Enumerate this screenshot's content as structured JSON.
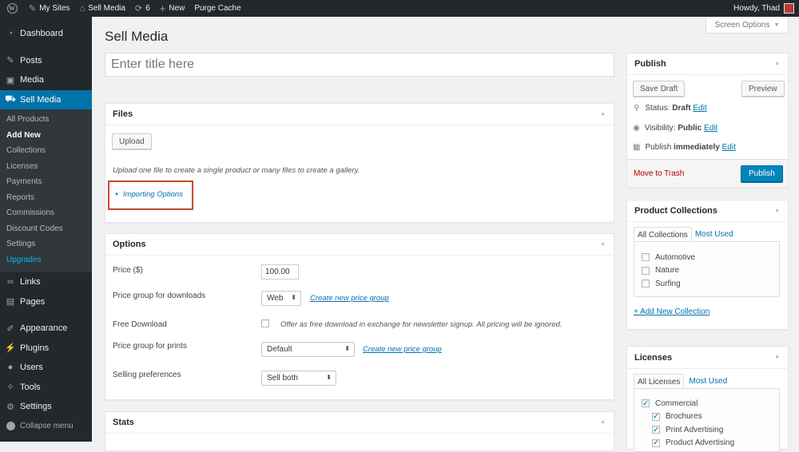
{
  "admin_bar": {
    "my_sites": "My Sites",
    "site_name": "Sell Media",
    "updates_count": "6",
    "new_label": "New",
    "purge_cache": "Purge Cache",
    "howdy": "Howdy, Thad"
  },
  "sidebar": {
    "dashboard": "Dashboard",
    "posts": "Posts",
    "media": "Media",
    "sell_media": "Sell Media",
    "submenu": [
      "All Products",
      "Add New",
      "Collections",
      "Licenses",
      "Payments",
      "Reports",
      "Commissions",
      "Discount Codes",
      "Settings",
      "Upgrades"
    ],
    "links": "Links",
    "pages": "Pages",
    "appearance": "Appearance",
    "plugins": "Plugins",
    "users": "Users",
    "tools": "Tools",
    "settings": "Settings",
    "collapse": "Collapse menu"
  },
  "page": {
    "title": "Sell Media",
    "screen_options": "Screen Options",
    "title_placeholder": "Enter title here"
  },
  "files_box": {
    "title": "Files",
    "upload_button": "Upload",
    "help_text": "Upload one file to create a single product or many files to create a gallery.",
    "importing_options": "Importing Options"
  },
  "options_box": {
    "title": "Options",
    "price_label": "Price ($)",
    "price_value": "100.00",
    "price_group_downloads_label": "Price group for downloads",
    "price_group_downloads_value": "Web",
    "create_price_group": "Create new price group",
    "free_download_label": "Free Download",
    "free_download_text": "Offer as free download in exchange for newsletter signup. All pricing will be ignored.",
    "price_group_prints_label": "Price group for prints",
    "price_group_prints_value": "Default",
    "selling_preferences_label": "Selling preferences",
    "selling_preferences_value": "Sell both"
  },
  "stats_box": {
    "title": "Stats"
  },
  "publish_box": {
    "title": "Publish",
    "save_draft": "Save Draft",
    "preview": "Preview",
    "status_label": "Status:",
    "status_value": "Draft",
    "visibility_label": "Visibility:",
    "visibility_value": "Public",
    "publish_label": "Publish",
    "publish_value": "immediately",
    "edit": "Edit",
    "move_to_trash": "Move to Trash",
    "publish_button": "Publish"
  },
  "collections_box": {
    "title": "Product Collections",
    "tab_all": "All Collections",
    "tab_most_used": "Most Used",
    "items": [
      "Automotive",
      "Nature",
      "Surfing"
    ],
    "add_new": "+ Add New Collection"
  },
  "licenses_box": {
    "title": "Licenses",
    "tab_all": "All Licenses",
    "tab_most_used": "Most Used",
    "items": [
      {
        "label": "Commercial",
        "checked": true,
        "indent": false
      },
      {
        "label": "Brochures",
        "checked": true,
        "indent": true
      },
      {
        "label": "Print Advertising",
        "checked": true,
        "indent": true
      },
      {
        "label": "Product Advertising",
        "checked": true,
        "indent": true
      }
    ]
  },
  "colors": {
    "accent": "#0073aa",
    "highlight_box": "#c9482b",
    "trash": "#a00"
  }
}
